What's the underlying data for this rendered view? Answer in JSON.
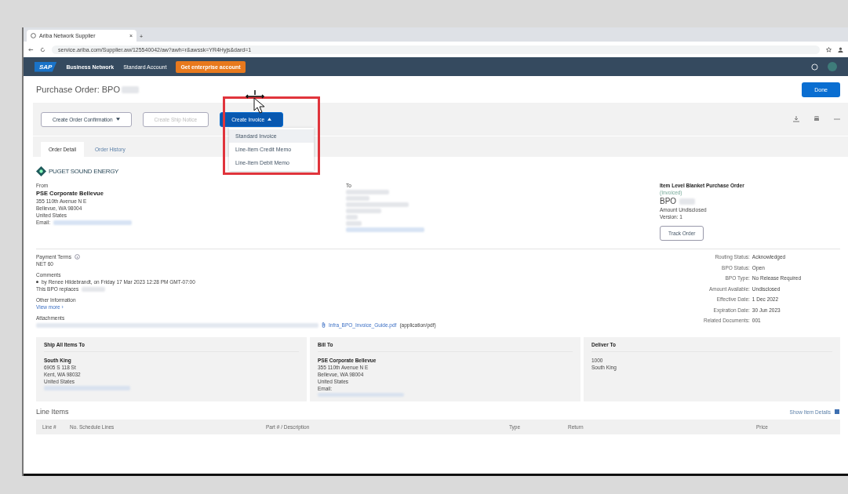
{
  "browser": {
    "tab": {
      "title": "Ariba Network Supplier",
      "close": "×"
    },
    "new_tab": "+",
    "url": "service.ariba.com/Supplier.aw/125540042/aw?awh=r&awssk=YR4Hyjs&dard=1"
  },
  "nav": {
    "logo": "SAP",
    "product": "Business Network",
    "account": "Standard Account",
    "upgrade": "Get enterprise account"
  },
  "title": "Purchase Order: BPO",
  "done": "Done",
  "toolbar": [
    {
      "label": "Create Order Confirmation",
      "kind": "dropdown",
      "disabled": false,
      "expanded": false
    },
    {
      "label": "Create Ship Notice",
      "kind": "plain",
      "disabled": true,
      "expanded": false
    },
    {
      "label": "Create Invoice",
      "kind": "primary",
      "disabled": false,
      "expanded": true
    }
  ],
  "menu": [
    {
      "label": "Standard Invoice",
      "selected": true
    },
    {
      "label": "Line-Item Credit Memo",
      "selected": false
    },
    {
      "label": "Line-Item Debit Memo",
      "selected": false
    }
  ],
  "tabs": [
    {
      "label": "Order Detail",
      "selected": true
    },
    {
      "label": "Order History",
      "selected": false
    }
  ],
  "logo": "PUGET SOUND ENERGY",
  "from": {
    "label": "From",
    "name": "PSE Corporate Bellevue",
    "lines": [
      "355 110th Avenue N E",
      "Bellevue, WA 98004",
      "United States"
    ],
    "email_label": "Email:"
  },
  "to": {
    "label": "To"
  },
  "order": {
    "type": "Item Level Blanket Purchase Order",
    "status": "(Invoiced)",
    "number": "BPO",
    "lines": [
      "Amount Undisclosed",
      "Version: 1"
    ],
    "track": "Track Order"
  },
  "payment": {
    "label": "Payment Terms",
    "value": "NET 60"
  },
  "comments": {
    "label": "Comments",
    "entry": "by Renee Hildebrandt, on Friday 17 Mar 2023 12:28 PM GMT-07:00",
    "text": "This BPO replaces"
  },
  "other": {
    "label": "Other Information",
    "link": "View more ›"
  },
  "attachments": {
    "label": "Attachments",
    "file": "Infra_BPO_Invoice_Guide.pdf",
    "type": "(application/pdf)"
  },
  "status": [
    {
      "label": "Routing Status:",
      "value": "Acknowledged"
    },
    {
      "label": "BPO Status:",
      "value": "Open"
    },
    {
      "label": "BPO Type:",
      "value": "No Release Required"
    },
    {
      "label": "Amount Available:",
      "value": "Undisclosed"
    },
    {
      "label": "Effective Date:",
      "value": "1 Dec 2022"
    },
    {
      "label": "Expiration Date:",
      "value": "30 Jun 2023"
    },
    {
      "label": "Related Documents:",
      "value": "001"
    }
  ],
  "cards": [
    {
      "title": "Ship All Items To",
      "name": "South King",
      "lines": [
        "6905 S 118 St",
        "Kent, WA 98032",
        "United States"
      ],
      "redacted": true
    },
    {
      "title": "Bill To",
      "name": "PSE Corporate Bellevue",
      "lines": [
        "355 110th Avenue N E",
        "Bellevue, WA 98004",
        "United States",
        "Email:"
      ],
      "redacted": true
    },
    {
      "title": "Deliver To",
      "lines": [
        "1000",
        "South King"
      ],
      "redacted": false
    }
  ],
  "line_items": {
    "title": "Line Items",
    "details": "Show Item Details",
    "columns": [
      "Line #",
      "No. Schedule Lines",
      "Part # / Description",
      "Type",
      "Return",
      "Price"
    ]
  }
}
